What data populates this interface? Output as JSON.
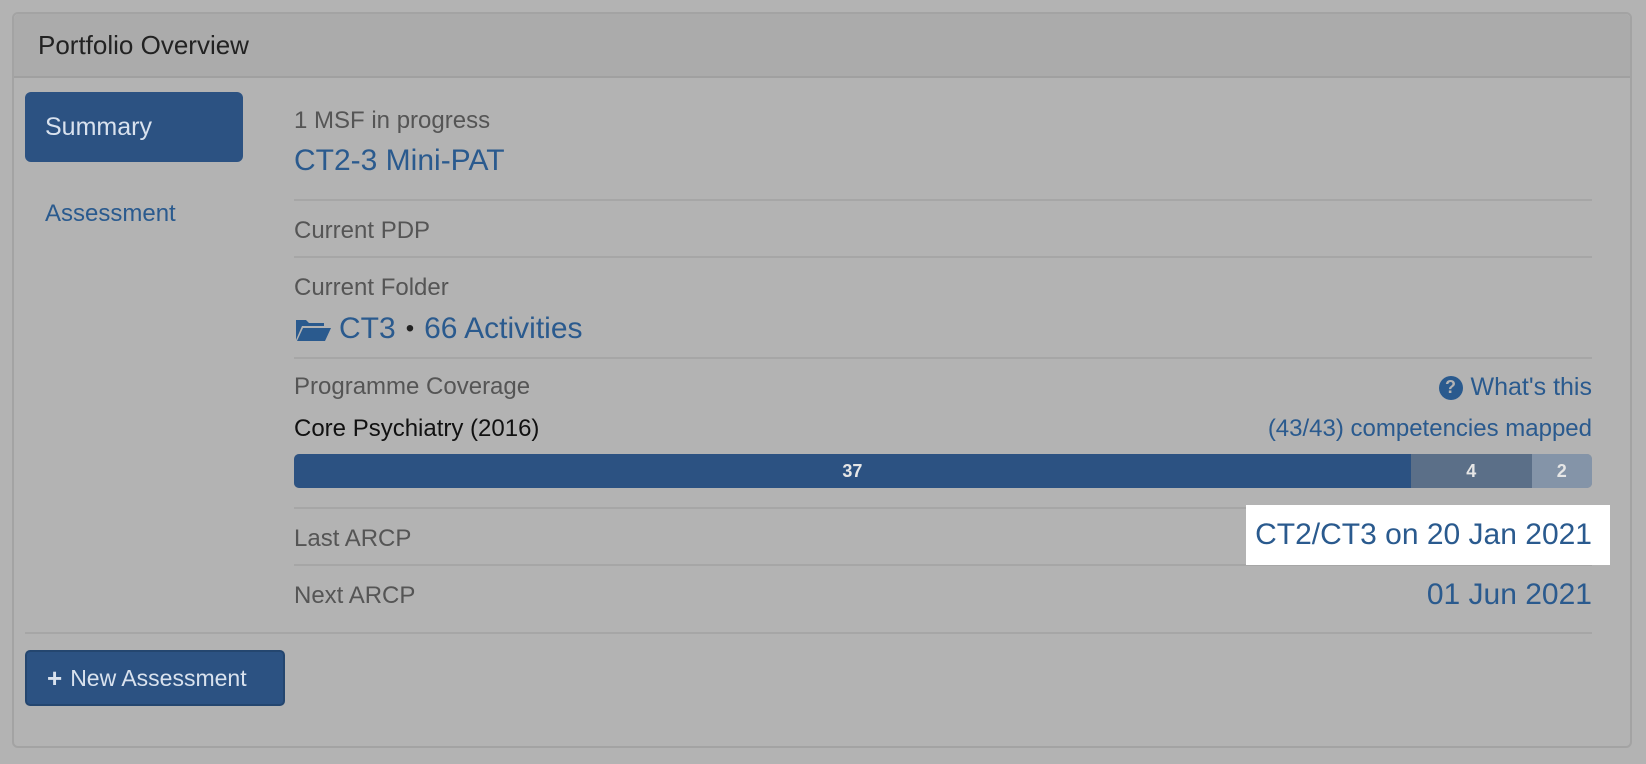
{
  "panel": {
    "title": "Portfolio Overview"
  },
  "nav": {
    "items": [
      {
        "label": "Summary",
        "active": true
      },
      {
        "label": "Assessment",
        "active": false
      }
    ]
  },
  "msf": {
    "label": "1 MSF in progress",
    "value": "CT2-3 Mini-PAT"
  },
  "pdp": {
    "label": "Current PDP"
  },
  "folder": {
    "label": "Current Folder",
    "icon": "folder-open-icon",
    "name": "CT3",
    "separator": "•",
    "activities": "66 Activities"
  },
  "coverage": {
    "label": "Programme Coverage",
    "help_icon": "question-circle-icon",
    "help_label": "What's this",
    "programme": "Core Psychiatry (2016)",
    "mapped": "(43/43) competencies mapped",
    "bar": [
      {
        "value": 37,
        "label": "37",
        "color": "#2c5282"
      },
      {
        "value": 4,
        "label": "4",
        "color": "#5b6f88"
      },
      {
        "value": 2,
        "label": "2",
        "color": "#8494a8"
      }
    ]
  },
  "arcp": {
    "last_label": "Last ARCP",
    "last_value": "CT2/CT3 on 20 Jan 2021",
    "next_label": "Next ARCP",
    "next_value": "01 Jun 2021"
  },
  "actions": {
    "new_assessment": "New Assessment",
    "new_icon": "plus-icon"
  },
  "colors": {
    "accent": "#2c5282",
    "link": "#2a5a8e",
    "background": "#b3b3b3"
  }
}
